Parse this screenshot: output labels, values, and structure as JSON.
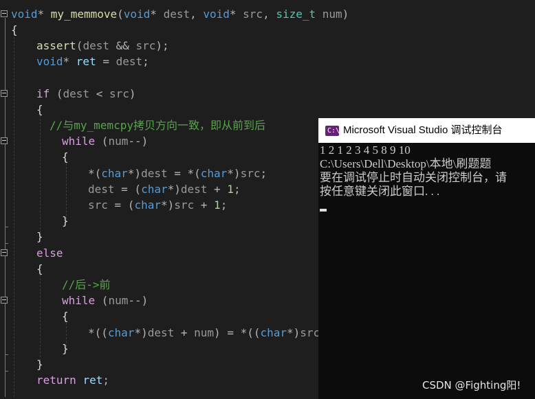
{
  "editor": {
    "l1": {
      "t1": "void",
      "t2": "* ",
      "t3": "my_memmove",
      "t4": "(",
      "t5": "void",
      "t6": "* ",
      "t7": "dest",
      "t8": ", ",
      "t9": "void",
      "t10": "* ",
      "t11": "src",
      "t12": ", ",
      "t13": "size_t",
      "t14": " ",
      "t15": "num",
      "t16": ")"
    },
    "l2": {
      "t1": "{"
    },
    "l3": {
      "t1": "assert",
      "t2": "(",
      "t3": "dest",
      "t4": " && ",
      "t5": "src",
      "t6": ");"
    },
    "l4": {
      "t1": "void",
      "t2": "* ",
      "t3": "ret",
      "t4": " = ",
      "t5": "dest",
      "t6": ";"
    },
    "l6": {
      "t1": "if",
      "t2": " (",
      "t3": "dest",
      "t4": " < ",
      "t5": "src",
      "t6": ")"
    },
    "l7": {
      "t1": "{"
    },
    "l8": {
      "t1": "//与my_memcpy拷贝方向一致，即从前到后"
    },
    "l9": {
      "t1": "while",
      "t2": " (",
      "t3": "num",
      "t4": "--)"
    },
    "l10": {
      "t1": "{"
    },
    "l11": {
      "t1": "*(",
      "t2": "char",
      "t3": "*)",
      "t4": "dest",
      "t5": " = *(",
      "t6": "char",
      "t7": "*)",
      "t8": "src",
      "t9": ";"
    },
    "l12": {
      "t1": "dest",
      "t2": " = (",
      "t3": "char",
      "t4": "*)",
      "t5": "dest",
      "t6": " + ",
      "t7": "1",
      "t8": ";"
    },
    "l13": {
      "t1": "src",
      "t2": " = (",
      "t3": "char",
      "t4": "*)",
      "t5": "src",
      "t6": " + ",
      "t7": "1",
      "t8": ";"
    },
    "l14": {
      "t1": "}"
    },
    "l15": {
      "t1": "}"
    },
    "l16": {
      "t1": "else"
    },
    "l17": {
      "t1": "{"
    },
    "l18": {
      "t1": "//后->前"
    },
    "l19": {
      "t1": "while",
      "t2": " (",
      "t3": "num",
      "t4": "--)"
    },
    "l20": {
      "t1": "{"
    },
    "l21": {
      "t1": "*((",
      "t2": "char",
      "t3": "*)",
      "t4": "dest",
      "t5": " + ",
      "t6": "num",
      "t7": ") = *((",
      "t8": "char",
      "t9": "*)",
      "t10": "src"
    },
    "l22": {
      "t1": "}"
    },
    "l23": {
      "t1": "}"
    },
    "l24": {
      "t1": "return",
      "t2": " ",
      "t3": "ret",
      "t4": ";"
    }
  },
  "console": {
    "title": "Microsoft Visual Studio 调试控制台",
    "icon": "visual-studio-console-icon",
    "icon_glyph": "C:\\",
    "lines": [
      "1 2 1 2 3 4 5 8 9 10",
      "C:\\Users\\Dell\\Desktop\\本地\\刷题题",
      "要在调试停止时自动关闭控制台，请",
      "按任意键关闭此窗口. . ."
    ]
  },
  "watermark": "CSDN @Fighting阳!",
  "colors": {
    "editor_bg": "#1e1e1e",
    "keyword": "#569cd6",
    "function": "#dcdcaa",
    "type": "#4ec9b0",
    "control": "#d8a0df",
    "comment": "#57a64a",
    "number": "#b5cea8",
    "console_bg": "#0c0c0c"
  }
}
